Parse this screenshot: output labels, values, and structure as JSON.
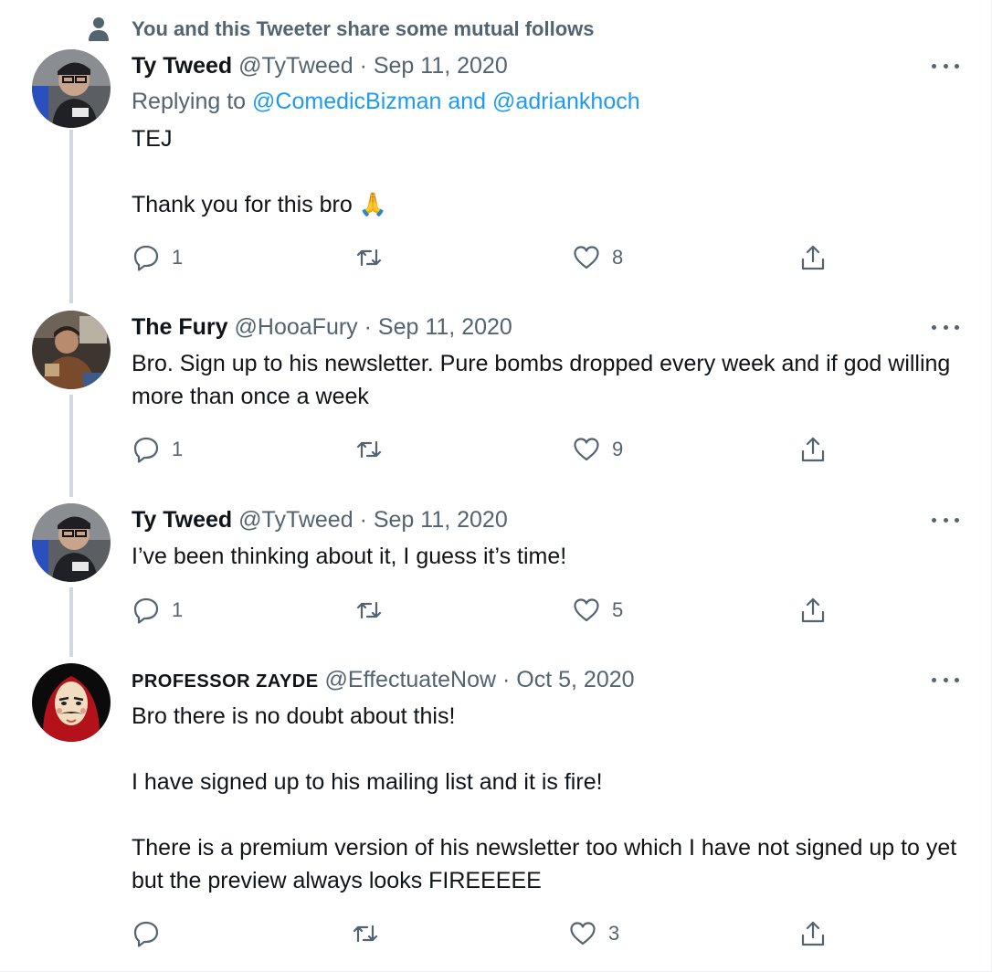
{
  "context": {
    "text": "You and this Tweeter share some mutual follows",
    "icon": "person-icon"
  },
  "tweets": [
    {
      "name": "Ty Tweed",
      "handle": "@TyTweed",
      "dot": "·",
      "date": "Sep 11, 2020",
      "replying_prefix": "Replying to",
      "replying_to_1": "@ComedicBizman",
      "replying_and": "and",
      "replying_to_2": "@adriankhoch",
      "body": "TEJ\n\nThank you for this bro 🙏",
      "replies": "1",
      "retweets": "",
      "likes": "8"
    },
    {
      "name": "The Fury",
      "handle": "@HooaFury",
      "dot": "·",
      "date": "Sep 11, 2020",
      "body": "Bro. Sign up to his newsletter. Pure bombs dropped every week and if god willing more than once a week",
      "replies": "1",
      "retweets": "",
      "likes": "9"
    },
    {
      "name": "Ty Tweed",
      "handle": "@TyTweed",
      "dot": "·",
      "date": "Sep 11, 2020",
      "body": "I’ve been thinking about it, I guess it’s time!",
      "replies": "1",
      "retweets": "",
      "likes": "5"
    },
    {
      "name": "PROFESSOR ZAYDE",
      "handle": "@EffectuateNow",
      "dot": "·",
      "date": "Oct 5, 2020",
      "body": "Bro there is no doubt about this!\n\nI have signed up to his mailing list and it is fire!\n\nThere is a premium version of his newsletter too which I have not signed up to yet but the preview always looks FIREEEEE",
      "replies": "",
      "retweets": "",
      "likes": "3"
    }
  ],
  "colors": {
    "text": "#0f1419",
    "secondary": "#536471",
    "link": "#1d9bf0",
    "thread_line": "#cfd9de"
  }
}
